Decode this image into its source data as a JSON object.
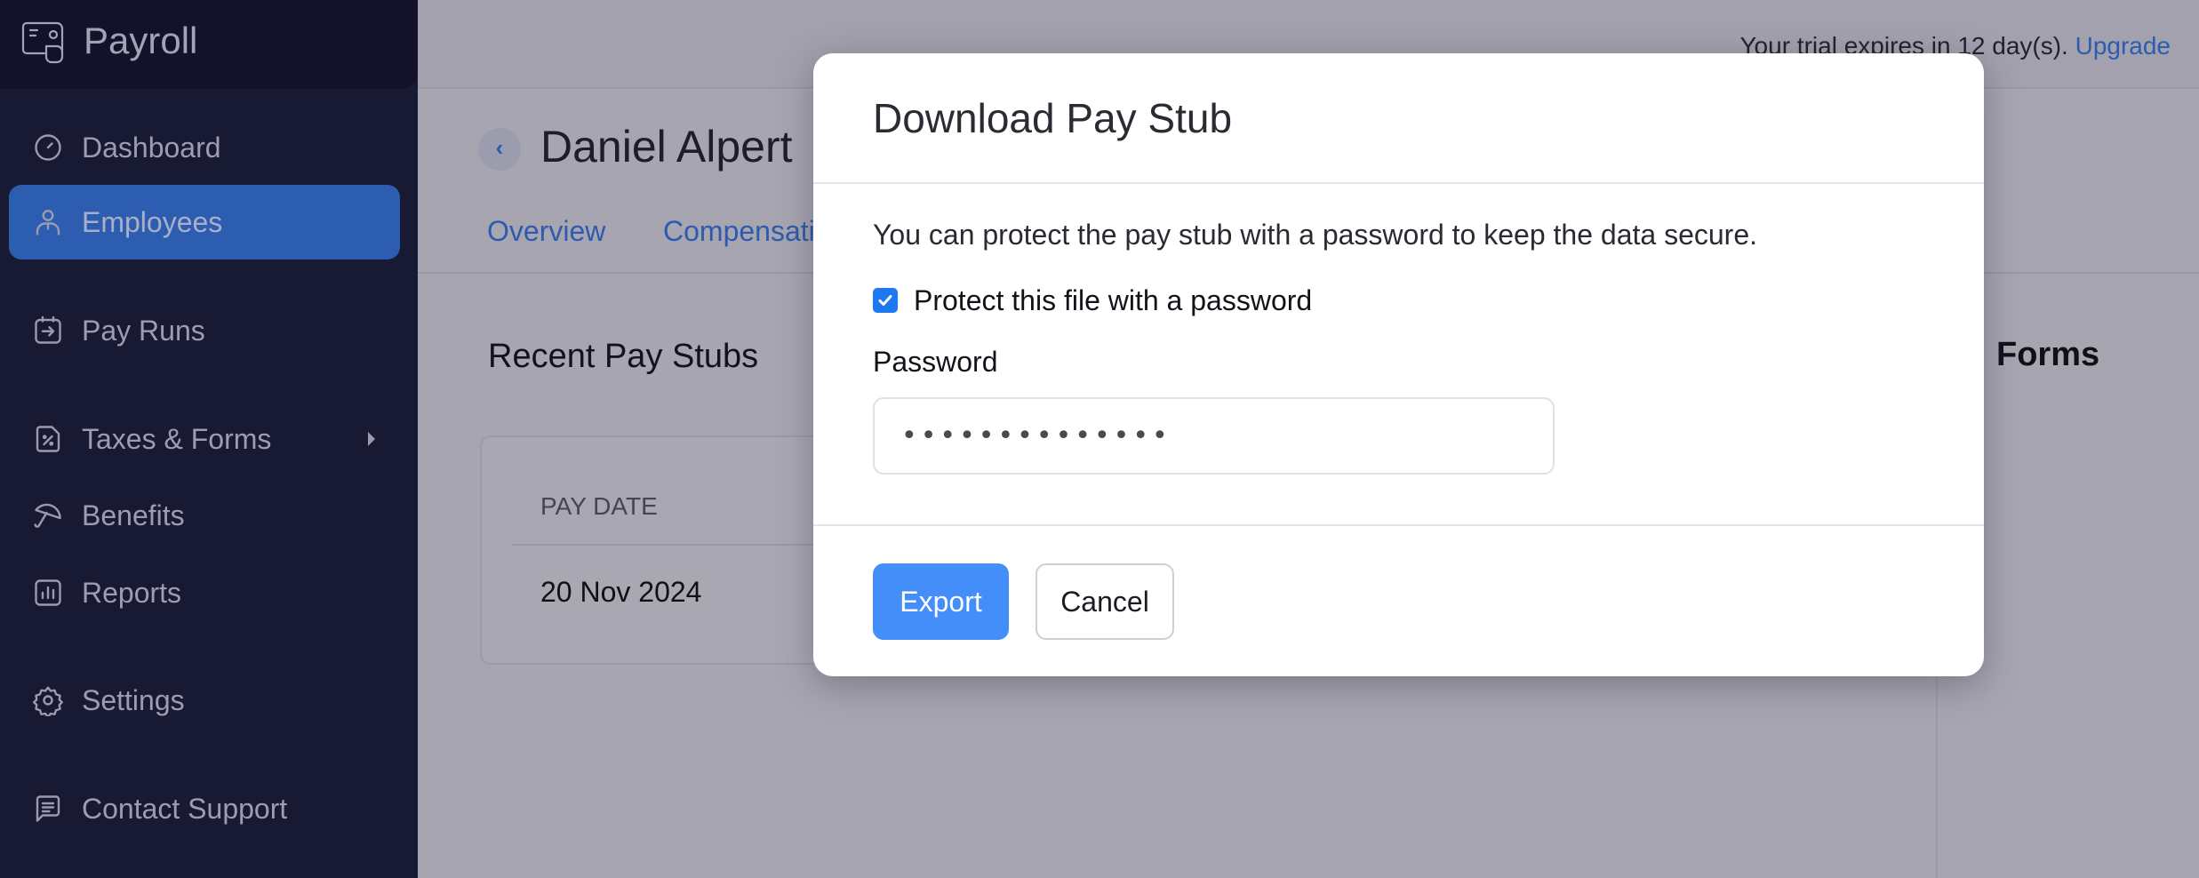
{
  "app": {
    "name": "Payroll",
    "logo_icon": "payroll-logo-icon"
  },
  "sidebar": {
    "items": [
      {
        "label": "Dashboard",
        "icon": "gauge-icon",
        "active": false
      },
      {
        "label": "Employees",
        "icon": "user-icon",
        "active": true
      },
      {
        "label": "Pay Runs",
        "icon": "calendar-arrow-icon",
        "active": false
      },
      {
        "label": "Taxes & Forms",
        "icon": "tax-document-icon",
        "active": false,
        "has_submenu": true
      },
      {
        "label": "Benefits",
        "icon": "umbrella-icon",
        "active": false
      },
      {
        "label": "Reports",
        "icon": "bar-chart-icon",
        "active": false
      },
      {
        "label": "Settings",
        "icon": "gear-icon",
        "active": false
      },
      {
        "label": "Contact Support",
        "icon": "chat-icon",
        "active": false
      }
    ]
  },
  "topbar": {
    "trial_text": "Your trial expires in 12 day(s).",
    "upgrade_label": "Upgrade"
  },
  "employee": {
    "name": "Daniel Alpert",
    "tabs": [
      "Overview",
      "Compensation"
    ]
  },
  "recent_pay_stubs": {
    "title": "Recent Pay Stubs",
    "columns": [
      "PAY DATE"
    ],
    "rows": [
      [
        "20 Nov 2024"
      ]
    ]
  },
  "right_panel": {
    "title": "Forms"
  },
  "modal": {
    "title": "Download Pay Stub",
    "description": "You can protect the pay stub with a password to keep the data secure.",
    "protect_checkbox": {
      "label": "Protect this file with a password",
      "checked": true
    },
    "password_label": "Password",
    "password_value": "••••••••••••••",
    "export_label": "Export",
    "cancel_label": "Cancel",
    "colors": {
      "primary": "#438ef9",
      "checkbox": "#1e78f0"
    }
  }
}
